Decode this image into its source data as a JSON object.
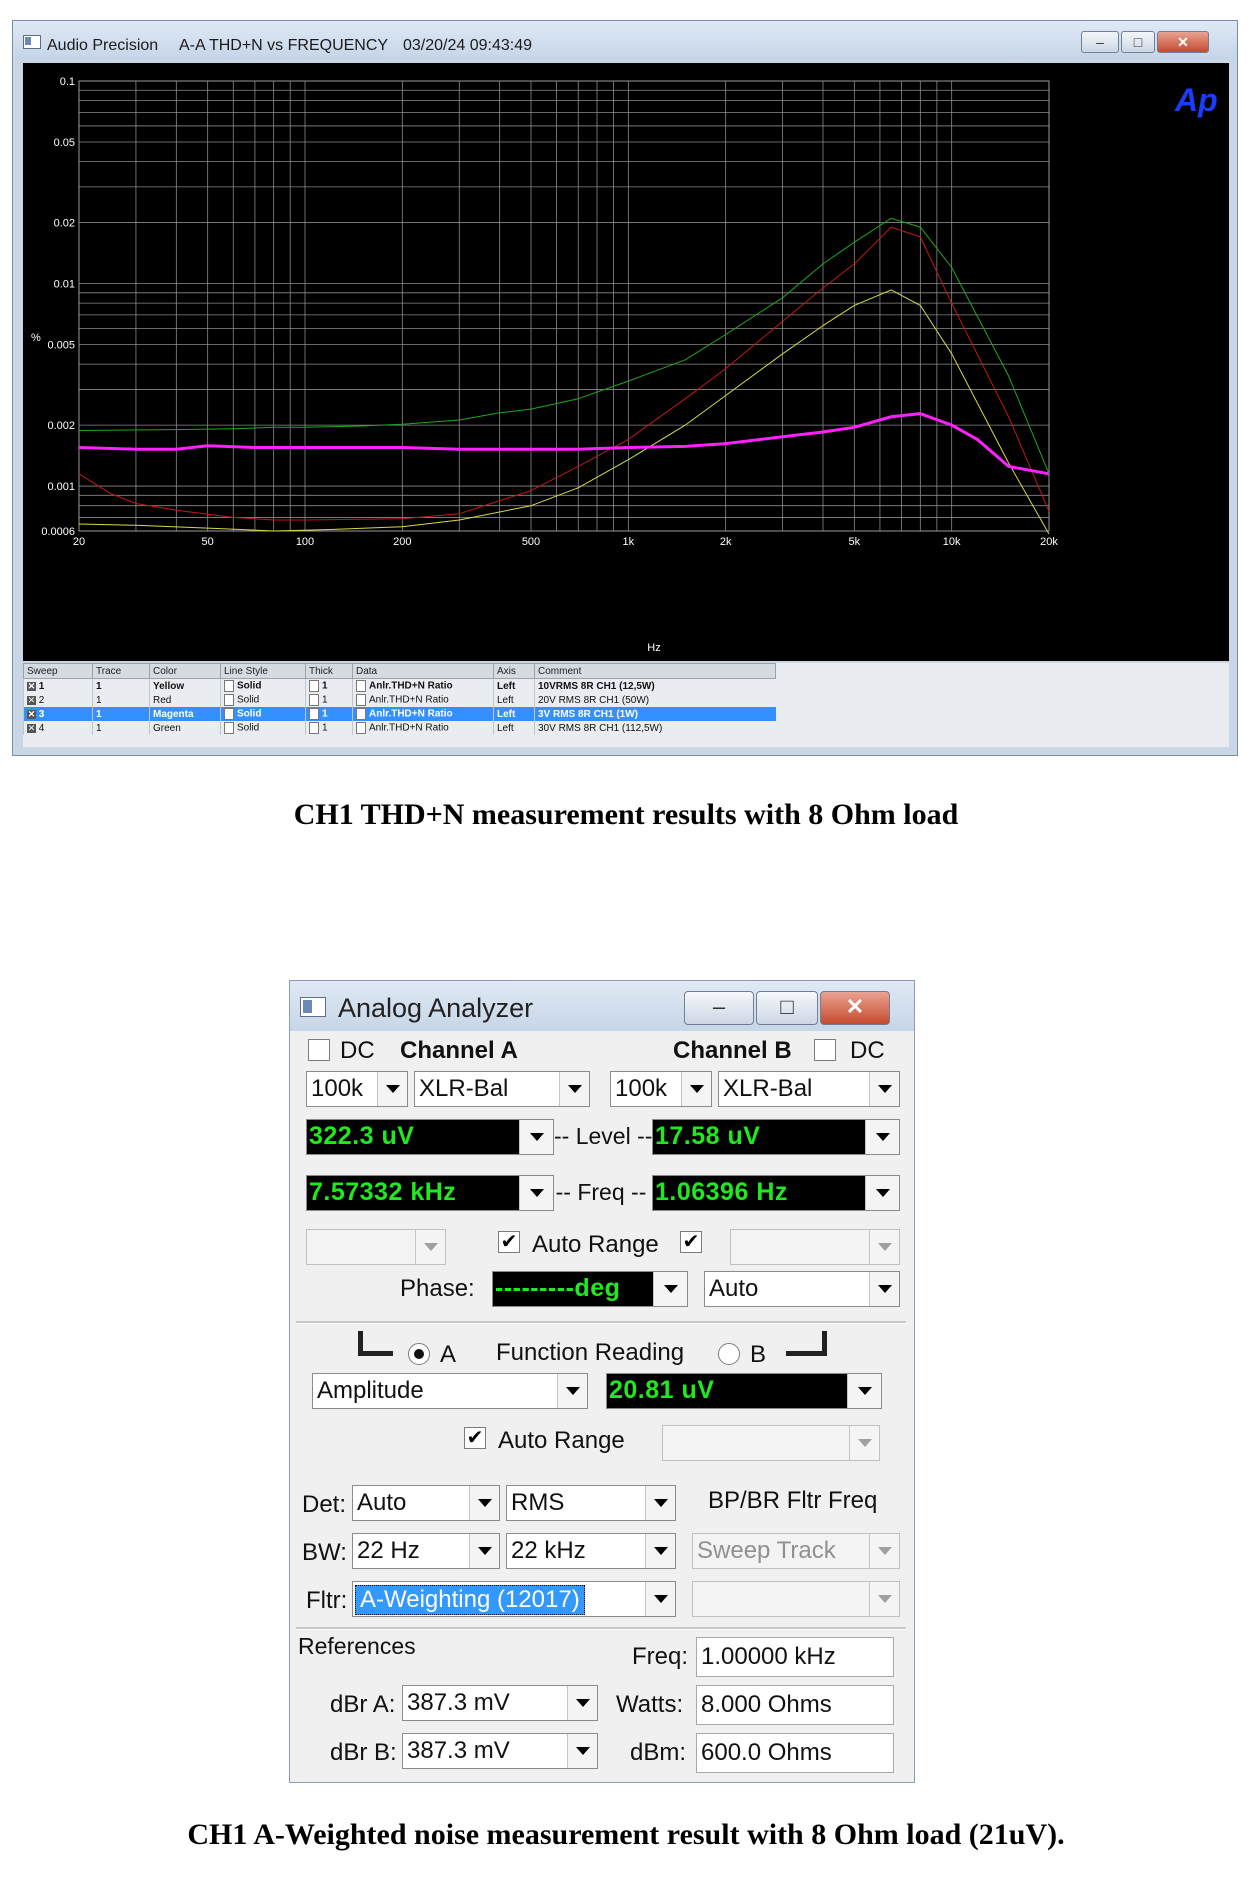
{
  "ap_window": {
    "app_name": "Audio Precision",
    "graph_title": "A-A THD+N vs FREQUENCY",
    "timestamp": "03/20/24 09:43:49",
    "logo_text": "Ap",
    "controls": {
      "minimize": "–",
      "maximize": "□",
      "close": "✕"
    },
    "legend": {
      "headers": [
        "Sweep",
        "Trace",
        "Color",
        "Line Style",
        "Thick",
        "Data",
        "Axis",
        "Comment"
      ],
      "rows": [
        {
          "sweep": "1",
          "trace": "1",
          "color": "Yellow",
          "style": "Solid",
          "thick": "1",
          "data": "Anlr.THD+N Ratio",
          "axis": "Left",
          "comment": "10VRMS 8R CH1  (12,5W)"
        },
        {
          "sweep": "2",
          "trace": "1",
          "color": "Red",
          "style": "Solid",
          "thick": "1",
          "data": "Anlr.THD+N Ratio",
          "axis": "Left",
          "comment": "20V RMS 8R CH1 (50W)"
        },
        {
          "sweep": "3",
          "trace": "1",
          "color": "Magenta",
          "style": "Solid",
          "thick": "1",
          "data": "Anlr.THD+N Ratio",
          "axis": "Left",
          "comment": "3V RMS 8R CH1 (1W)"
        },
        {
          "sweep": "4",
          "trace": "1",
          "color": "Green",
          "style": "Solid",
          "thick": "1",
          "data": "Anlr.THD+N Ratio",
          "axis": "Left",
          "comment": "30V RMS 8R CH1 (112,5W)"
        }
      ]
    }
  },
  "chart_data": {
    "type": "line",
    "title": "A-A THD+N vs FREQUENCY",
    "xlabel": "Hz",
    "ylabel": "%",
    "x_scale": "log",
    "y_scale": "log",
    "xlim": [
      20,
      20000
    ],
    "ylim": [
      0.0006,
      0.1
    ],
    "grid": true,
    "y_ticks": [
      0.1,
      0.05,
      0.02,
      0.01,
      0.005,
      0.002,
      0.001,
      0.0006
    ],
    "y_tick_labels": [
      "0.1",
      "0.05",
      "0.02",
      "0.01",
      "0.005",
      "0.002",
      "0.001",
      "0.0006"
    ],
    "x_ticks": [
      20,
      50,
      100,
      200,
      500,
      1000,
      2000,
      5000,
      10000,
      20000
    ],
    "x_tick_labels": [
      "20",
      "50",
      "100",
      "200",
      "500",
      "1k",
      "2k",
      "5k",
      "10k",
      "20k"
    ],
    "series": [
      {
        "name": "10VRMS 8R CH1  (12,5W)",
        "color": "#d8d84a",
        "width": 1,
        "points": [
          [
            20,
            0.00065
          ],
          [
            30,
            0.00064
          ],
          [
            50,
            0.00062
          ],
          [
            80,
            0.0006
          ],
          [
            120,
            0.00061
          ],
          [
            200,
            0.00063
          ],
          [
            300,
            0.00068
          ],
          [
            500,
            0.0008
          ],
          [
            700,
            0.00098
          ],
          [
            1000,
            0.00135
          ],
          [
            1500,
            0.002
          ],
          [
            2000,
            0.0028
          ],
          [
            3000,
            0.0045
          ],
          [
            4000,
            0.0062
          ],
          [
            5000,
            0.0078
          ],
          [
            6500,
            0.0093
          ],
          [
            8000,
            0.0078
          ],
          [
            10000,
            0.0045
          ],
          [
            15000,
            0.0013
          ],
          [
            20000,
            0.00058
          ]
        ]
      },
      {
        "name": "20V RMS 8R CH1 (50W)",
        "color": "#c01818",
        "width": 1,
        "points": [
          [
            20,
            0.00115
          ],
          [
            25,
            0.00092
          ],
          [
            30,
            0.00082
          ],
          [
            40,
            0.00076
          ],
          [
            60,
            0.0007
          ],
          [
            80,
            0.00068
          ],
          [
            100,
            0.00068
          ],
          [
            200,
            0.00069
          ],
          [
            300,
            0.00073
          ],
          [
            500,
            0.00095
          ],
          [
            700,
            0.00125
          ],
          [
            1000,
            0.0017
          ],
          [
            1500,
            0.0027
          ],
          [
            2000,
            0.0038
          ],
          [
            3000,
            0.0065
          ],
          [
            4000,
            0.0095
          ],
          [
            5000,
            0.0125
          ],
          [
            6500,
            0.019
          ],
          [
            8000,
            0.017
          ],
          [
            10000,
            0.008
          ],
          [
            15000,
            0.0022
          ],
          [
            20000,
            0.00075
          ]
        ]
      },
      {
        "name": "3V RMS 8R CH1 (1W)",
        "color": "#ff20ff",
        "width": 3,
        "points": [
          [
            20,
            0.00155
          ],
          [
            30,
            0.00152
          ],
          [
            40,
            0.00152
          ],
          [
            50,
            0.00158
          ],
          [
            70,
            0.00155
          ],
          [
            100,
            0.00155
          ],
          [
            200,
            0.00155
          ],
          [
            300,
            0.00152
          ],
          [
            500,
            0.00152
          ],
          [
            700,
            0.00152
          ],
          [
            1000,
            0.00155
          ],
          [
            1500,
            0.00157
          ],
          [
            2000,
            0.00162
          ],
          [
            3000,
            0.00175
          ],
          [
            4000,
            0.00185
          ],
          [
            5000,
            0.00195
          ],
          [
            6500,
            0.0022
          ],
          [
            8000,
            0.00228
          ],
          [
            10000,
            0.002
          ],
          [
            12000,
            0.0017
          ],
          [
            15000,
            0.00125
          ],
          [
            20000,
            0.00115
          ]
        ]
      },
      {
        "name": "30V RMS 8R CH1 (112,5W)",
        "color": "#1fa81f",
        "width": 1,
        "points": [
          [
            20,
            0.00188
          ],
          [
            40,
            0.0019
          ],
          [
            60,
            0.00192
          ],
          [
            80,
            0.00195
          ],
          [
            100,
            0.00195
          ],
          [
            150,
            0.00198
          ],
          [
            200,
            0.00202
          ],
          [
            300,
            0.00212
          ],
          [
            400,
            0.0023
          ],
          [
            500,
            0.0024
          ],
          [
            700,
            0.0027
          ],
          [
            1000,
            0.0033
          ],
          [
            1500,
            0.0042
          ],
          [
            2000,
            0.0056
          ],
          [
            3000,
            0.0085
          ],
          [
            4000,
            0.0125
          ],
          [
            5000,
            0.016
          ],
          [
            6500,
            0.021
          ],
          [
            8000,
            0.019
          ],
          [
            10000,
            0.012
          ],
          [
            15000,
            0.0035
          ],
          [
            20000,
            0.00115
          ]
        ]
      }
    ]
  },
  "caption1": "CH1 THD+N measurement results with 8 Ohm load",
  "analyzer": {
    "title": "Analog Analyzer",
    "dc_label": "DC",
    "channel_a": "Channel A",
    "channel_b": "Channel B",
    "a_range": "100k",
    "a_input": "XLR-Bal",
    "b_range": "100k",
    "b_input": "XLR-Bal",
    "level_label": "-- Level --",
    "freq_label": "-- Freq --",
    "a_level": "322.3  uV",
    "b_level": "17.58   uV",
    "a_freq": "7.57332 kHz",
    "b_freq": "1.06396  Hz",
    "auto_range": "Auto Range",
    "auto_range_check": "✔",
    "phase_label": "Phase:",
    "phase_value": "---------deg",
    "phase_mode": "Auto",
    "radio_a": "A",
    "radio_b": "B",
    "function_reading": "Function Reading",
    "function": "Amplitude",
    "function_value": "20.81    uV",
    "det_label": "Det:",
    "det_value": "Auto",
    "det_mode": "RMS",
    "bp_label": "BP/BR Fltr Freq",
    "bw_label": "BW:",
    "bw_low": "22 Hz",
    "bw_high": "22 kHz",
    "sweep_track": "Sweep Track",
    "fltr_label": "Fltr:",
    "fltr_value": "A-Weighting  (12017)",
    "references": "References",
    "ref_freq_label": "Freq:",
    "ref_freq": "1.00000 kHz",
    "dbra_label": "dBr A:",
    "dbra_value": "387.3   mV",
    "watts_label": "Watts:",
    "watts_value": "8.000     Ohms",
    "dbrb_label": "dBr B:",
    "dbrb_value": "387.3   mV",
    "dbm_label": "dBm:",
    "dbm_value": "600.0     Ohms"
  },
  "caption2": "CH1 A-Weighted noise measurement result with 8 Ohm load (21uV)."
}
